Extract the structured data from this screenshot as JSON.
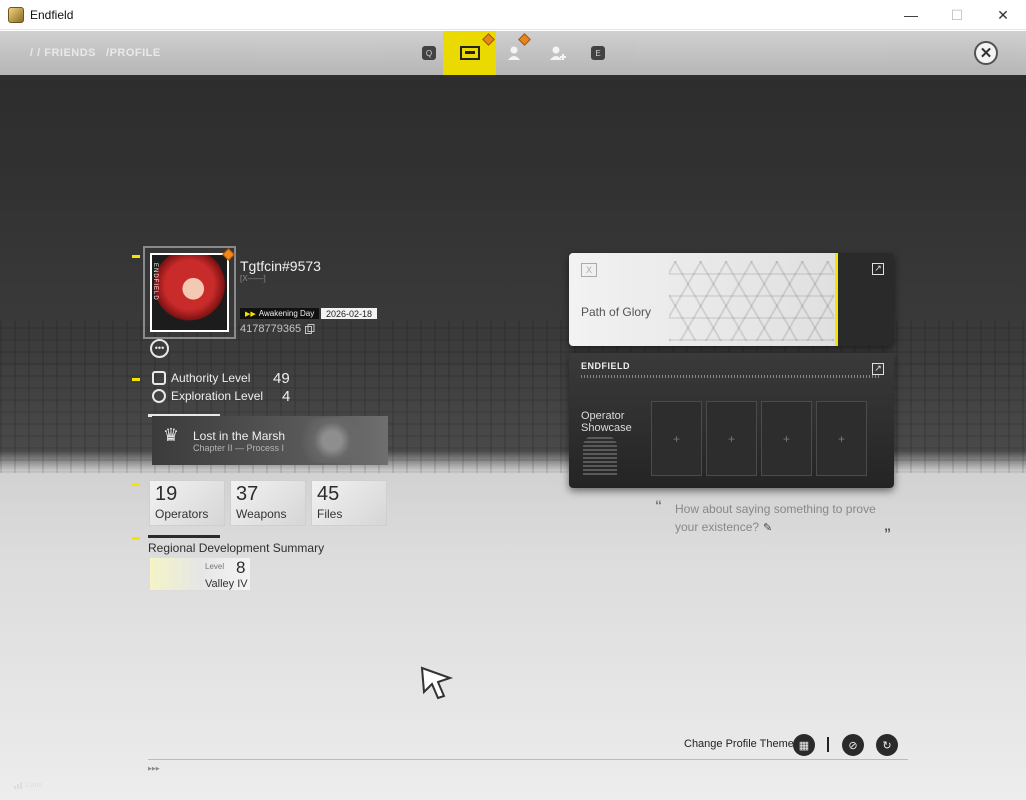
{
  "window": {
    "title": "Endfield",
    "minimize": "—",
    "maximize": "☐",
    "close": "✕"
  },
  "nav": {
    "breadcrumb": [
      "/ / FRIENDS",
      "/PROFILE"
    ],
    "keys": {
      "left": "Q",
      "right": "E"
    },
    "active_tab": "profile-card"
  },
  "profile": {
    "username": "Tgtfcin#9573",
    "sub_id": "[X——]",
    "awakening_label": "Awakening Day",
    "awakening_date": "2026-02-18",
    "uid": "4178779365",
    "avatar_side_text": "ENDFIELD"
  },
  "levels": {
    "authority": {
      "label": "Authority Level",
      "value": "49"
    },
    "exploration": {
      "label": "Exploration Level",
      "value": "4"
    }
  },
  "quest": {
    "title": "Lost in the Marsh",
    "subtitle": "Chapter II — Process I"
  },
  "stats": [
    {
      "value": "19",
      "label": "Operators"
    },
    {
      "value": "37",
      "label": "Weapons"
    },
    {
      "value": "45",
      "label": "Files"
    }
  ],
  "region": {
    "title": "Regional Development Summary",
    "level_label": "Level",
    "level": "8",
    "name": "Valley IV"
  },
  "glory": {
    "title": "Path of Glory"
  },
  "showcase": {
    "brand": "ENDFIELD",
    "title": "Operator Showcase",
    "slot_symbol": "+"
  },
  "signature": {
    "text": "How about saying something to prove your existence?",
    "open_quote": "“",
    "close_quote": "”"
  },
  "footer": {
    "theme_label": "Change Profile Theme",
    "signal": "21ms"
  },
  "colors": {
    "accent_yellow": "#f5e400",
    "badge_orange": "#f08a1c",
    "dark_panel": "#2a2a2a"
  }
}
